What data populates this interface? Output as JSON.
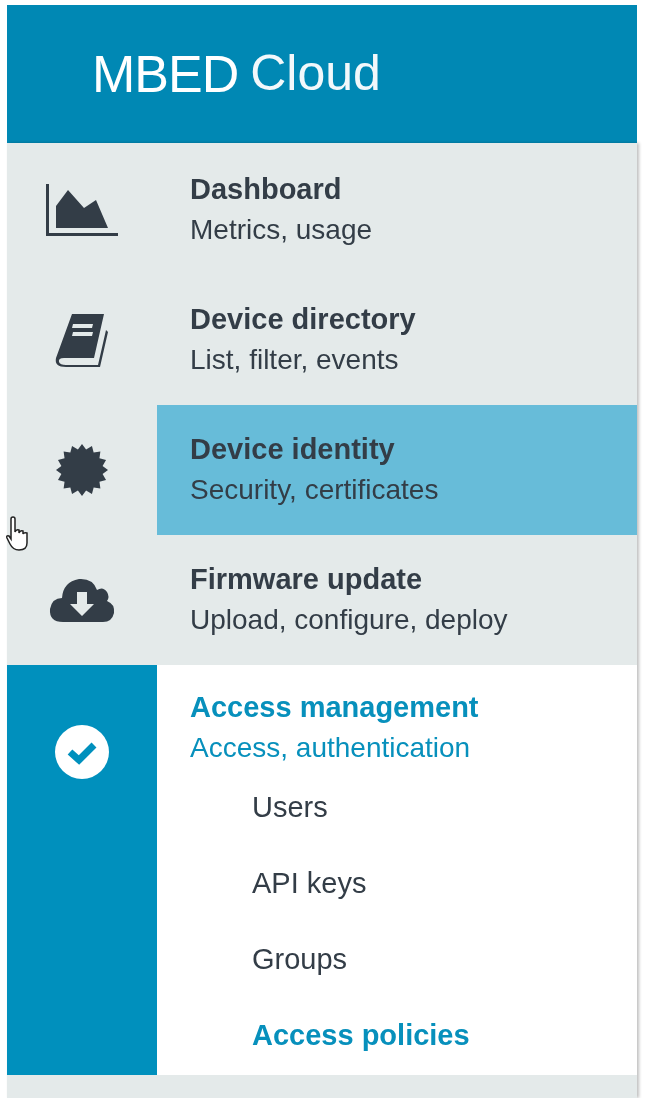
{
  "header": {
    "brand_bold": "MBED",
    "brand_light": "Cloud"
  },
  "nav": [
    {
      "kind": "chart",
      "title": "Dashboard",
      "subtitle": "Metrics, usage",
      "hovered": false,
      "active": false
    },
    {
      "kind": "book",
      "title": "Device directory",
      "subtitle": "List, filter, events",
      "hovered": false,
      "active": false
    },
    {
      "kind": "badge",
      "title": "Device identity",
      "subtitle": "Security, certificates",
      "hovered": true,
      "active": false
    },
    {
      "kind": "cloud",
      "title": "Firmware update",
      "subtitle": "Upload, configure, deploy",
      "hovered": false,
      "active": false
    },
    {
      "kind": "check",
      "title": "Access management",
      "subtitle": "Access, authentication",
      "hovered": false,
      "active": true,
      "children": [
        {
          "label": "Users",
          "selected": false
        },
        {
          "label": "API keys",
          "selected": false
        },
        {
          "label": "Groups",
          "selected": false
        },
        {
          "label": "Access policies",
          "selected": true
        }
      ]
    }
  ]
}
